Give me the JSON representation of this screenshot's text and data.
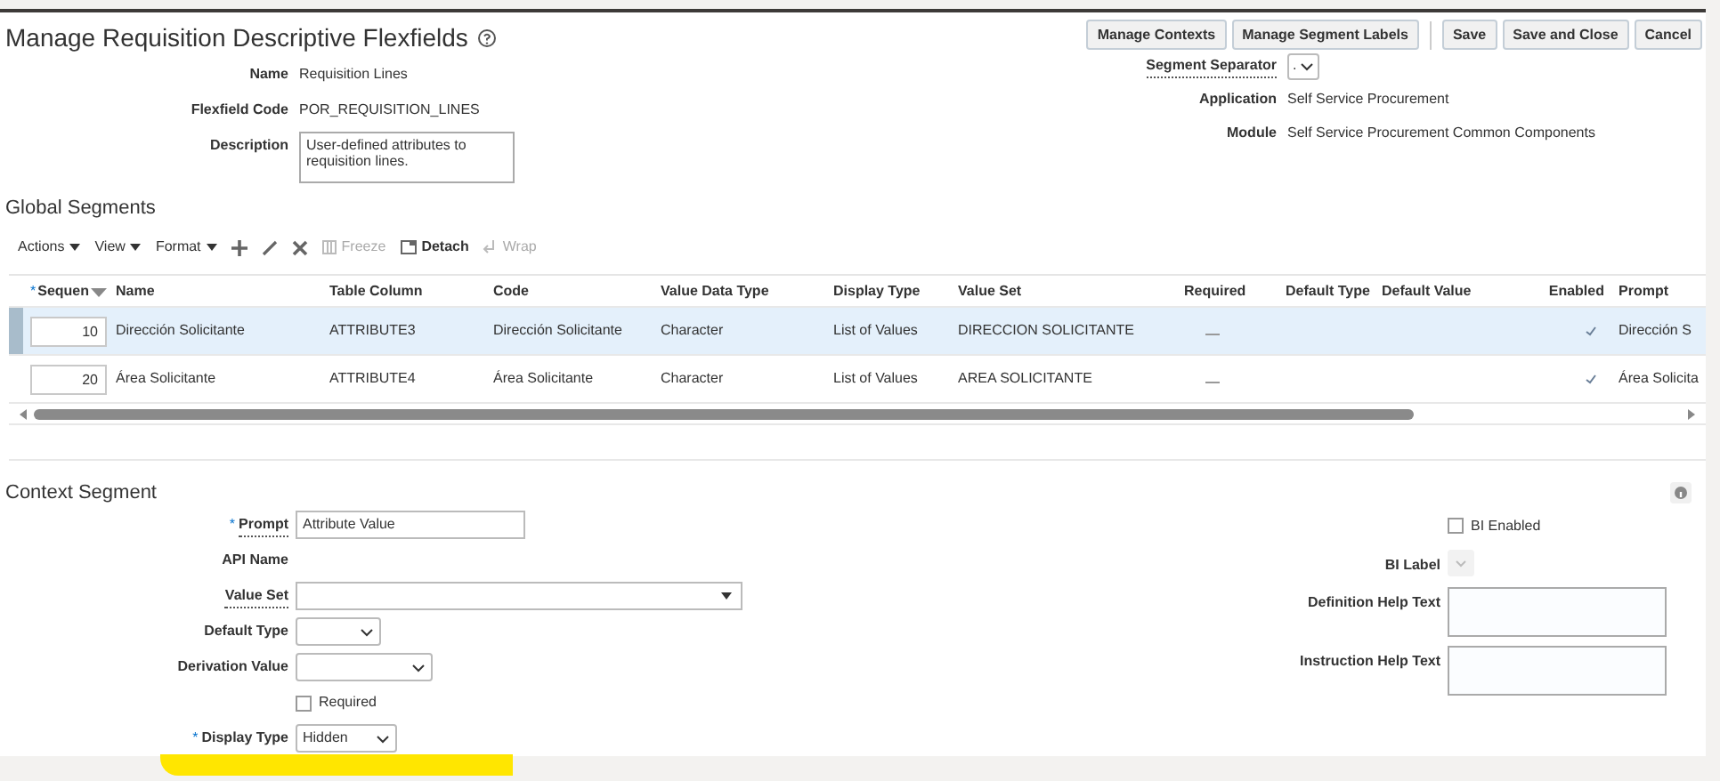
{
  "page": {
    "title": "Manage Requisition Descriptive Flexfields"
  },
  "manage_buttons": [
    {
      "label": "Manage Contexts"
    },
    {
      "label": "Manage Segment Labels"
    }
  ],
  "action_buttons": [
    {
      "label": "Save"
    },
    {
      "label": "Save and Close"
    },
    {
      "label": "Cancel"
    }
  ],
  "details_left": [
    {
      "label": "Name",
      "kind": "text",
      "value": "Requisition Lines"
    },
    {
      "label": "Flexfield Code",
      "kind": "text",
      "value": "POR_REQUISITION_LINES"
    },
    {
      "label": "Description",
      "kind": "textarea",
      "value": "User-defined attributes to requisition lines."
    }
  ],
  "details_right": [
    {
      "label": "Segment Separator",
      "kind": "select",
      "value": "."
    },
    {
      "label": "Application",
      "kind": "text",
      "value": "Self Service Procurement"
    },
    {
      "label": "Module",
      "kind": "text",
      "value": "Self Service Procurement Common Components"
    }
  ],
  "global_segments": {
    "title": "Global Segments",
    "toolbar": [
      {
        "kind": "menu",
        "label": "Actions"
      },
      {
        "kind": "menu",
        "label": "View"
      },
      {
        "kind": "menu",
        "label": "Format"
      },
      {
        "kind": "add"
      },
      {
        "kind": "edit"
      },
      {
        "kind": "delete"
      },
      {
        "kind": "freeze",
        "label": "Freeze",
        "disabled": true
      },
      {
        "kind": "detach",
        "label": "Detach",
        "disabled": false
      },
      {
        "kind": "wrap",
        "label": "Wrap",
        "disabled": true
      }
    ],
    "columns": [
      {
        "label": "Sequen",
        "required_mark": "*"
      },
      {
        "label": "Name"
      },
      {
        "label": "Table Column"
      },
      {
        "label": "Code"
      },
      {
        "label": "Value Data Type"
      },
      {
        "label": "Display Type"
      },
      {
        "label": "Value Set"
      },
      {
        "label": "Required"
      },
      {
        "label": "Default Type"
      },
      {
        "label": "Default Value"
      },
      {
        "label": "Enabled"
      },
      {
        "label": "Prompt"
      }
    ],
    "rows": [
      {
        "selected": true,
        "sequence": "10",
        "name": "Dirección Solicitante",
        "table_column": "ATTRIBUTE3",
        "code": "Dirección Solicitante",
        "value_data_type": "Character",
        "display_type": "List of Values",
        "value_set": "DIRECCION SOLICITANTE",
        "required": false,
        "enabled": true,
        "prompt": "Dirección S"
      },
      {
        "selected": false,
        "sequence": "20",
        "name": "Área Solicitante",
        "table_column": "ATTRIBUTE4",
        "code": "Área Solicitante",
        "value_data_type": "Character",
        "display_type": "List of Values",
        "value_set": "AREA SOLICITANTE",
        "required": false,
        "enabled": true,
        "prompt": "Área Solicita"
      }
    ]
  },
  "context_segment": {
    "title": "Context Segment",
    "left_fields": [
      {
        "label": "Prompt",
        "kind": "text",
        "value": "Attribute Value",
        "required_mark": "*"
      },
      {
        "label": "API Name",
        "kind": "label"
      },
      {
        "label": "Value Set",
        "kind": "combo"
      },
      {
        "label": "Default Type",
        "kind": "select"
      },
      {
        "label": "Derivation Value",
        "kind": "select_wide"
      },
      {
        "label": "Required",
        "kind": "checkbox",
        "checked": false
      },
      {
        "label": "Display Type",
        "kind": "select",
        "value": "Hidden",
        "required_mark": "*"
      }
    ],
    "right_fields": [
      {
        "label": "BI Enabled",
        "kind": "checkbox",
        "checked": false
      },
      {
        "label": "BI Label",
        "kind": "select_disabled"
      },
      {
        "label": "Definition Help Text",
        "kind": "textarea"
      },
      {
        "label": "Instruction Help Text",
        "kind": "textarea"
      }
    ]
  }
}
